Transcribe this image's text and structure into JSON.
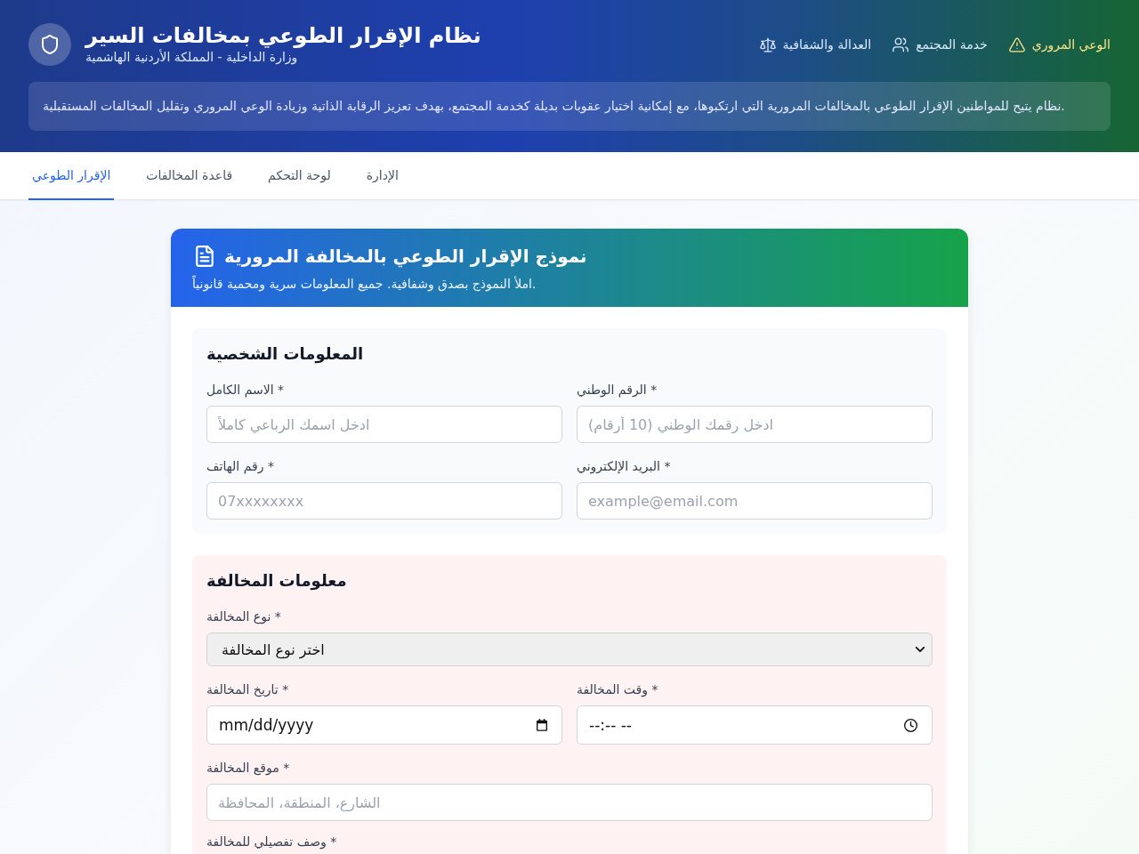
{
  "header": {
    "title": "نظام الإقرار الطوعي بمخالفات السير",
    "subtitle": "وزارة الداخلية - المملكة الأردنية الهاشمية",
    "features": [
      {
        "label": "الوعي المروري",
        "color": "#fde68a"
      },
      {
        "label": "خدمة المجتمع",
        "color": "#dbeafe"
      },
      {
        "label": "العدالة والشفافية",
        "color": "#dbeafe"
      }
    ],
    "description": "نظام يتيح للمواطنين الإقرار الطوعي بالمخالفات المرورية التي ارتكبوها، مع إمكانية اختيار عقوبات بديلة كخدمة المجتمع، بهدف تعزيز الرقابة الذاتية وزيادة الوعي المروري وتقليل المخالفات المستقبلية."
  },
  "tabs": [
    {
      "label": "الإدارة",
      "selected": false
    },
    {
      "label": "لوحة التحكم",
      "selected": false
    },
    {
      "label": "قاعدة المخالفات",
      "selected": false
    },
    {
      "label": "الإقرار الطوعي",
      "selected": true
    }
  ],
  "form": {
    "title": "نموذج الإقرار الطوعي بالمخالفة المرورية",
    "subtitle": "املأ النموذج بصدق وشفافية. جميع المعلومات سرية ومحمية قانونياً.",
    "sections": [
      {
        "title": "المعلومات الشخصية",
        "color": "#f9fafb",
        "rows": [
          [
            {
              "kind": "text",
              "label": "الرقم الوطني *",
              "placeholder": "ادخل رقمك الوطني (10 أرقام)"
            },
            {
              "kind": "text",
              "label": "الاسم الكامل *",
              "placeholder": "ادخل اسمك الرباعي كاملاً"
            }
          ],
          [
            {
              "kind": "text",
              "label": "البريد الإلكتروني *",
              "placeholder": "example@email.com"
            },
            {
              "kind": "text",
              "label": "رقم الهاتف *",
              "placeholder": "07xxxxxxxx"
            }
          ]
        ]
      },
      {
        "title": "معلومات المخالفة",
        "color": "#fef2f2",
        "rows": [
          [
            {
              "kind": "select",
              "label": "نوع المخالفة *",
              "value": "اختر نوع المخالفة"
            }
          ],
          [
            {
              "kind": "time",
              "label": "وقت المخالفة *",
              "value": "--:-- --"
            },
            {
              "kind": "date",
              "label": "تاريخ المخالفة *",
              "value": "mm/dd/yyyy"
            }
          ],
          [
            {
              "kind": "text",
              "label": "موقع المخالفة *",
              "placeholder": "الشارع، المنطقة، المحافظة"
            }
          ],
          [
            {
              "label": "وصف تفصيلي للمخالفة *"
            }
          ]
        ]
      }
    ]
  }
}
